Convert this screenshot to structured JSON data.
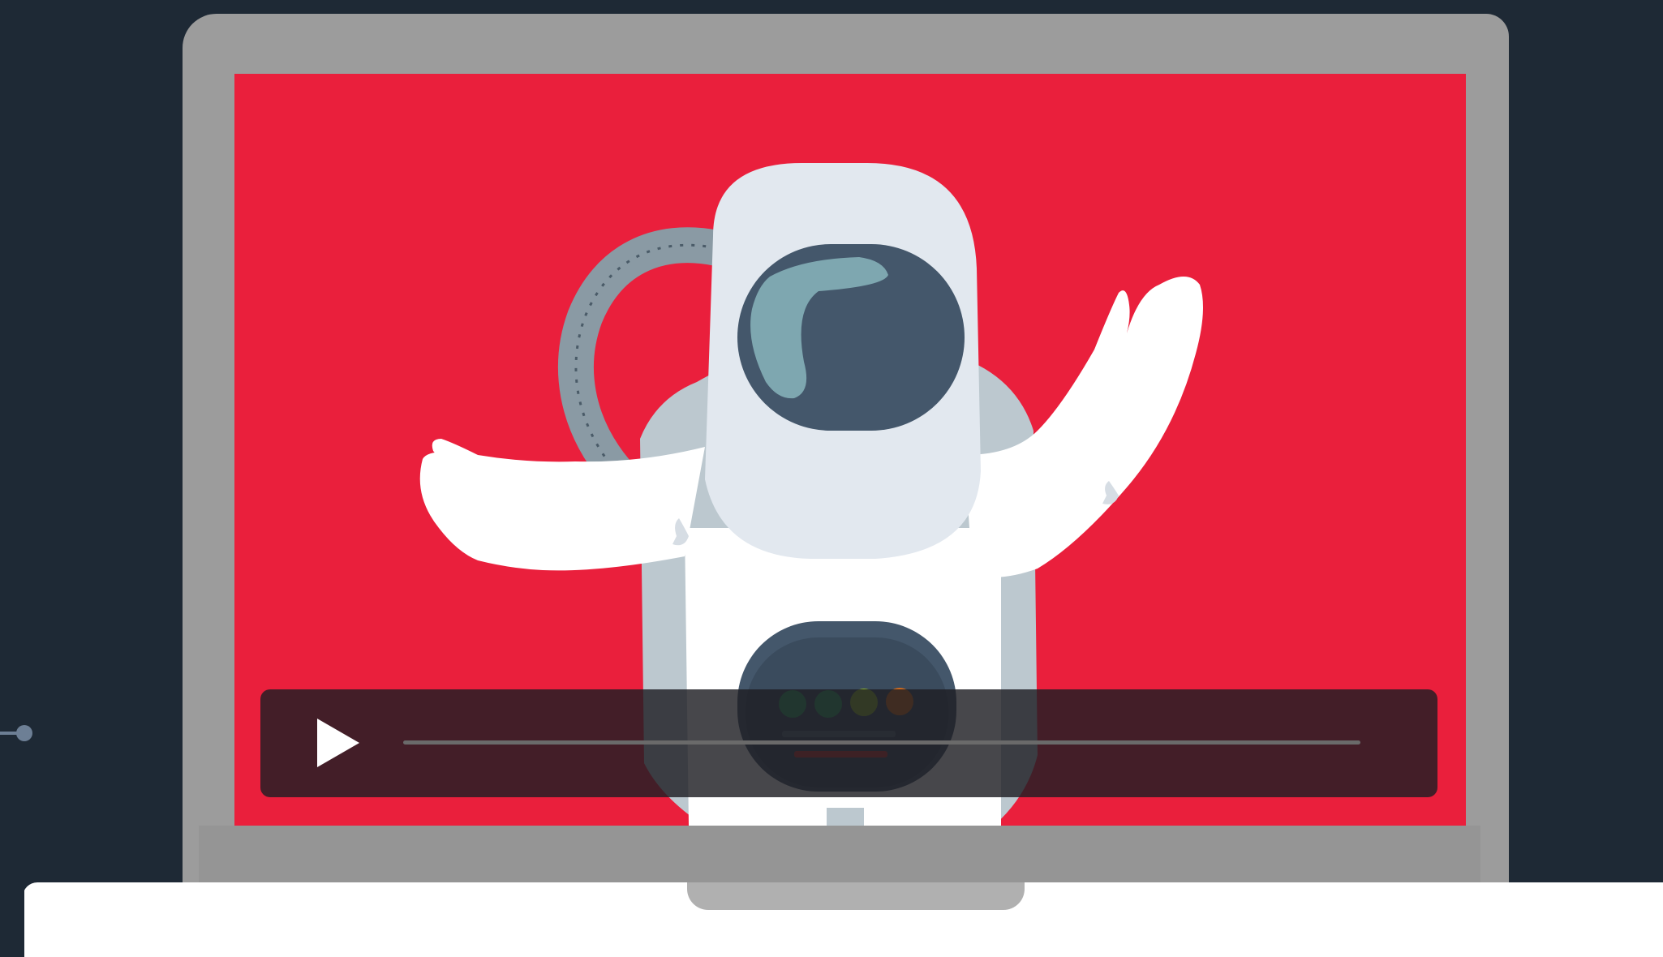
{
  "video_player": {
    "play_icon": "play-triangle-icon",
    "progress": 0,
    "colors": {
      "screen_background": "#ea1f3c",
      "controls_bar": "#1e1e23",
      "play_icon": "#ffffff",
      "progress_track": "#6a6a6a"
    }
  },
  "illustration": {
    "subject": "astronaut",
    "colors": {
      "suit": "#ffffff",
      "helmet": "#e2e8ef",
      "visor": "#44576b",
      "visor_highlight": "#7ea7b0",
      "backpack": "#bcc8cf",
      "tube": "#8a9aa4",
      "chest_panel": "#44576b"
    }
  },
  "device": {
    "colors": {
      "background": "#1e2935",
      "lid": "#9c9c9c",
      "base": "#ffffff",
      "trackpad_notch": "#b0b0b0"
    }
  }
}
